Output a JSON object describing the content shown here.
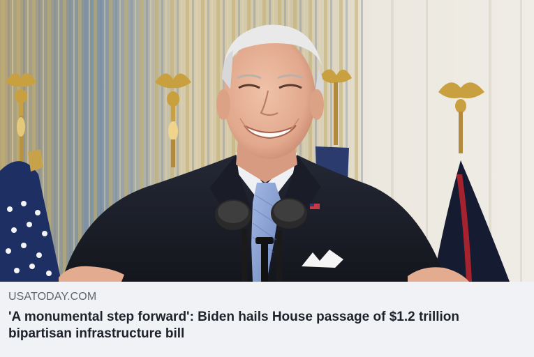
{
  "link_preview": {
    "image": {
      "description": "Man in dark suit and blue tie smiling at podium with two microphones in front of gold-striped curtains and flags",
      "colors": {
        "curtain_light": "#e6e2d8",
        "curtain_stripe": "#b9a774",
        "curtain_blue": "#6e88a8",
        "suit": "#1c1f29",
        "shirt": "#eef0f4",
        "tie": "#8ea6d6",
        "skin": "#e8b49a",
        "hair": "#e9e9ea",
        "gold": "#c9a040",
        "flag_blue": "#1e2f63",
        "flag_red": "#a4232e"
      }
    },
    "source": "USATODAY.COM",
    "headline": "'A monumental step forward': Biden hails House passage of $1.2 trillion bipartisan infrastructure bill",
    "colors": {
      "background": "#f0f2f5",
      "source_text": "#606770",
      "headline_text": "#1d2129"
    }
  }
}
